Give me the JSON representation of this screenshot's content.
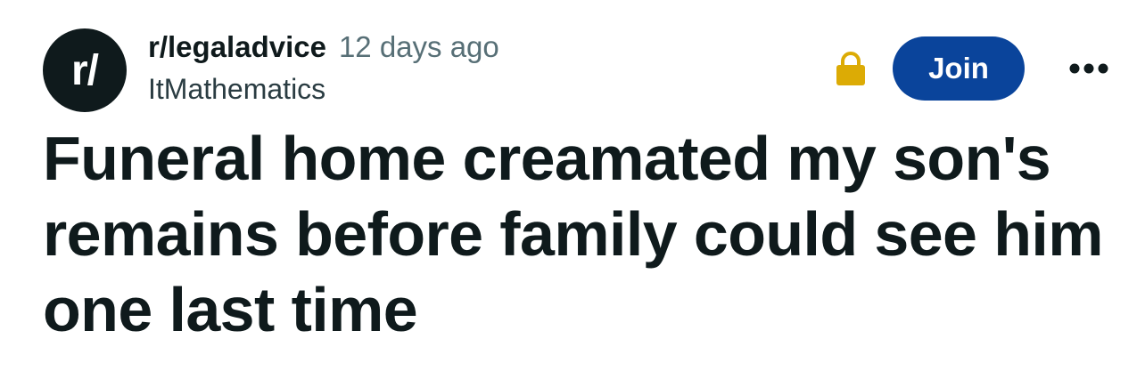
{
  "post": {
    "avatar_text": "r/",
    "subreddit": "r/legaladvice",
    "time_ago": "12 days ago",
    "author": "ItMathematics",
    "title": "Funeral home creamated my son's remains before family could see him one last time"
  },
  "actions": {
    "join_label": "Join",
    "lock_icon": "lock-icon",
    "more_icon": "more-options-icon"
  },
  "colors": {
    "join_background": "#0a449b",
    "lock": "#dcab05",
    "text_primary": "#0f1a1c",
    "text_secondary": "#576f76"
  }
}
